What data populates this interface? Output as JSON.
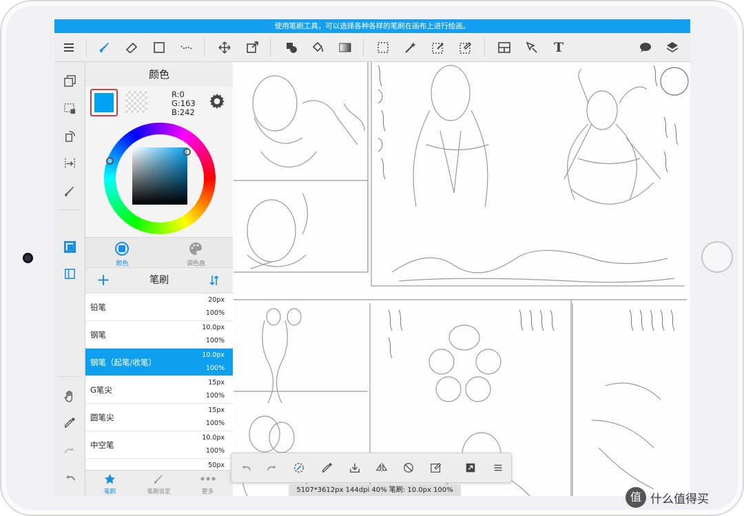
{
  "hint_bar": {
    "text": "使用笔刷工具，可以选择各种各样的笔刷在画布上进行绘画。"
  },
  "toolbar": {
    "tools": [
      "menu-icon",
      "brush-icon",
      "eraser-icon",
      "rectangle-icon",
      "dot-icon",
      "move-icon",
      "transform-icon",
      "fill-shape-icon",
      "bucket-icon",
      "gradient-icon",
      "select-rect-icon",
      "magic-wand-icon",
      "select-pen-icon",
      "select-eraser-icon",
      "panel-icon",
      "select-move-icon",
      "text-icon",
      "speech-bubble-icon",
      "layers-icon"
    ],
    "text_tool_label": "T"
  },
  "color_panel": {
    "title": "颜色",
    "current_color": "#00A3F2",
    "r": "R:0",
    "g": "G:163",
    "b": "B:242",
    "tabs": [
      {
        "label": "颜色",
        "active": true
      },
      {
        "label": "调色盘",
        "active": false
      }
    ]
  },
  "brush_panel": {
    "title": "笔刷",
    "add_label": "+",
    "items": [
      {
        "name": "铅笔",
        "size": "20px",
        "opacity": "100%",
        "selected": false
      },
      {
        "name": "钢笔",
        "size": "10.0px",
        "opacity": "100%",
        "selected": false
      },
      {
        "name": "钢笔（起笔/收笔）",
        "size": "10.0px",
        "opacity": "100%",
        "selected": true
      },
      {
        "name": "G笔尖",
        "size": "15px",
        "opacity": "100%",
        "selected": false
      },
      {
        "name": "圆笔尖",
        "size": "15px",
        "opacity": "100%",
        "selected": false
      },
      {
        "name": "中空笔",
        "size": "10.0px",
        "opacity": "100%",
        "selected": false
      },
      {
        "name": "",
        "size": "50px",
        "opacity": "",
        "selected": false
      }
    ],
    "bottom_tabs": [
      {
        "label": "笔刷",
        "active": true
      },
      {
        "label": "笔刷设定",
        "active": false
      },
      {
        "label": "更多",
        "active": false
      }
    ]
  },
  "status": {
    "text": "5107*3612px 144dpi 40% 笔刷: 10.0px 100%"
  },
  "watermark": {
    "logo": "值",
    "text": "什么值得买"
  },
  "accent_color": "#149FF0"
}
